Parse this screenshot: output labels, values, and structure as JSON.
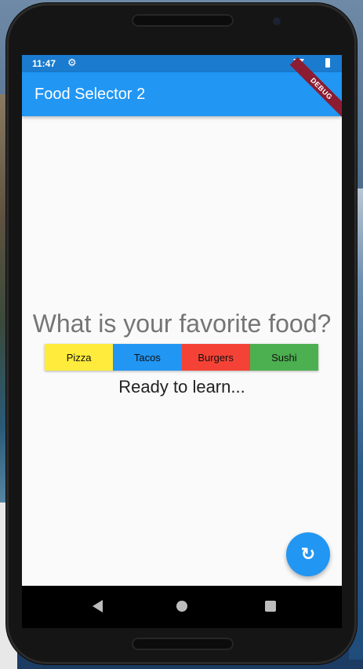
{
  "status_bar": {
    "time": "11:47",
    "gear_icon": "gear-icon",
    "wifi_icon": "wifi-icon",
    "battery_icon": "battery-icon"
  },
  "app_bar": {
    "title": "Food Selector 2",
    "debug_banner": "DEBUG"
  },
  "main": {
    "question": "What is your favorite food?",
    "buttons": [
      {
        "label": "Pizza",
        "color": "#ffeb3b"
      },
      {
        "label": "Tacos",
        "color": "#2196f3"
      },
      {
        "label": "Burgers",
        "color": "#f44336"
      },
      {
        "label": "Sushi",
        "color": "#4caf50"
      }
    ],
    "status": "Ready to learn..."
  },
  "fab": {
    "icon": "refresh-icon",
    "glyph": "↻"
  },
  "nav_bar": {
    "back_icon": "back-icon",
    "home_icon": "home-icon",
    "recents_icon": "recents-icon"
  },
  "colors": {
    "primary": "#2196f3",
    "status_bar": "#1a7bcf",
    "debug": "#8b1c31"
  }
}
